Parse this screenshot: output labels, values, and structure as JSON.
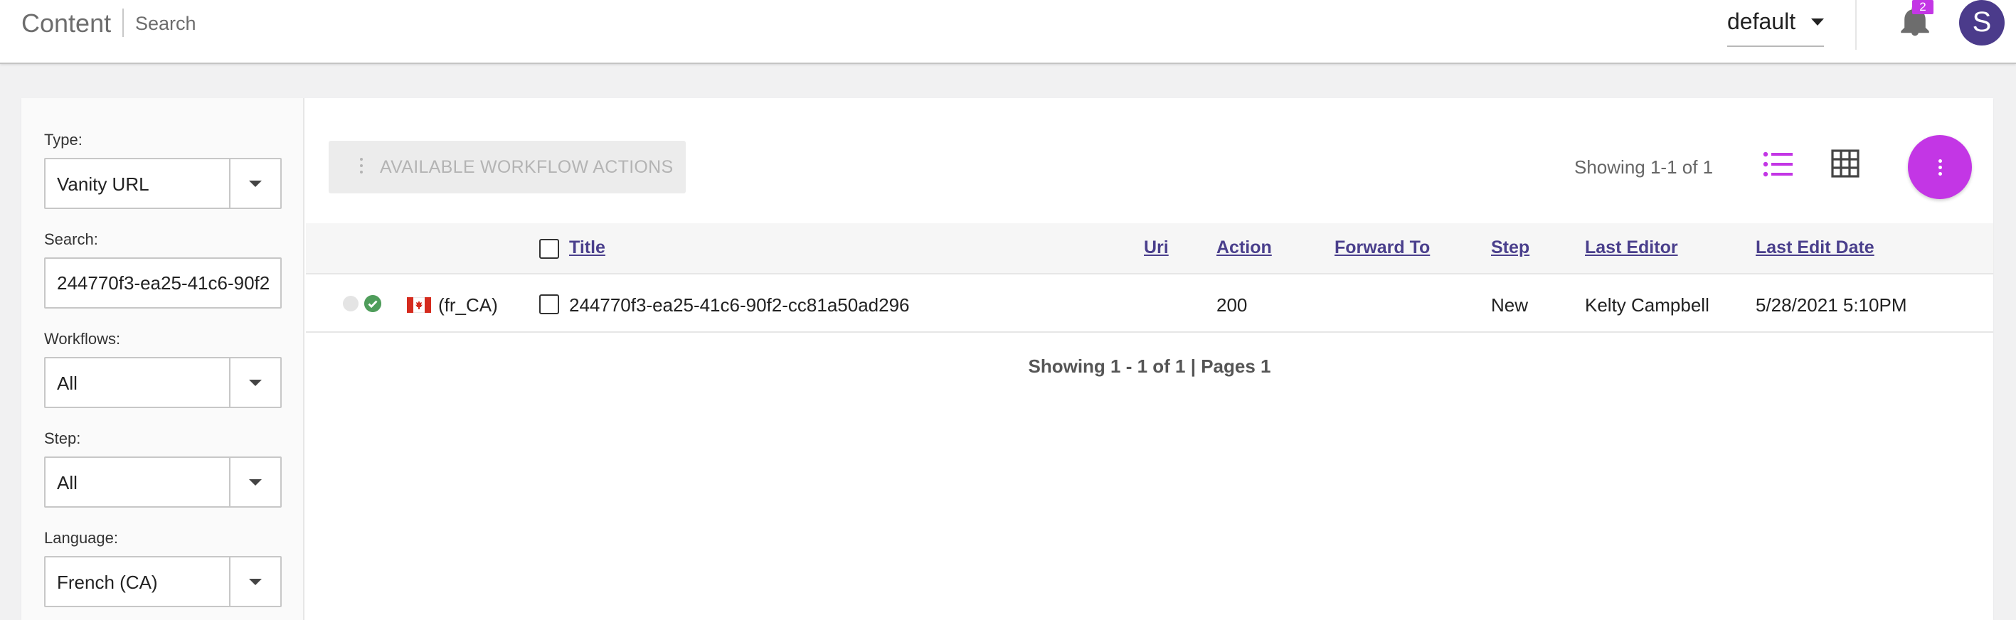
{
  "header": {
    "title": "Content",
    "subtitle": "Search",
    "site": "default",
    "notification_count": "2",
    "avatar_initial": "S"
  },
  "filters": {
    "type": {
      "label": "Type:",
      "value": "Vanity URL"
    },
    "search": {
      "label": "Search:",
      "value": "244770f3-ea25-41c6-90f2"
    },
    "workflows": {
      "label": "Workflows:",
      "value": "All"
    },
    "step": {
      "label": "Step:",
      "value": "All"
    },
    "language": {
      "label": "Language:",
      "value": "French (CA)"
    }
  },
  "toolbar": {
    "workflow_actions": "AVAILABLE WORKFLOW ACTIONS",
    "showing": "Showing 1-1 of 1"
  },
  "table": {
    "columns": {
      "title": "Title",
      "uri": "Uri",
      "action": "Action",
      "forward_to": "Forward To",
      "step": "Step",
      "last_editor": "Last Editor",
      "last_edit_date": "Last Edit Date"
    },
    "rows": [
      {
        "locale": "(fr_CA)",
        "title": "244770f3-ea25-41c6-90f2-cc81a50ad296",
        "uri": "",
        "action": "200",
        "forward_to": "",
        "step": "New",
        "last_editor": "Kelty Campbell",
        "last_edit_date": "5/28/2021 5:10PM"
      }
    ]
  },
  "pagination": {
    "text": "Showing 1 - 1 of 1 | Pages 1"
  },
  "colors": {
    "accent": "#c336e5",
    "link": "#4a3f8c",
    "avatar": "#4b3b8b",
    "status_ok": "#4f9d5b"
  }
}
